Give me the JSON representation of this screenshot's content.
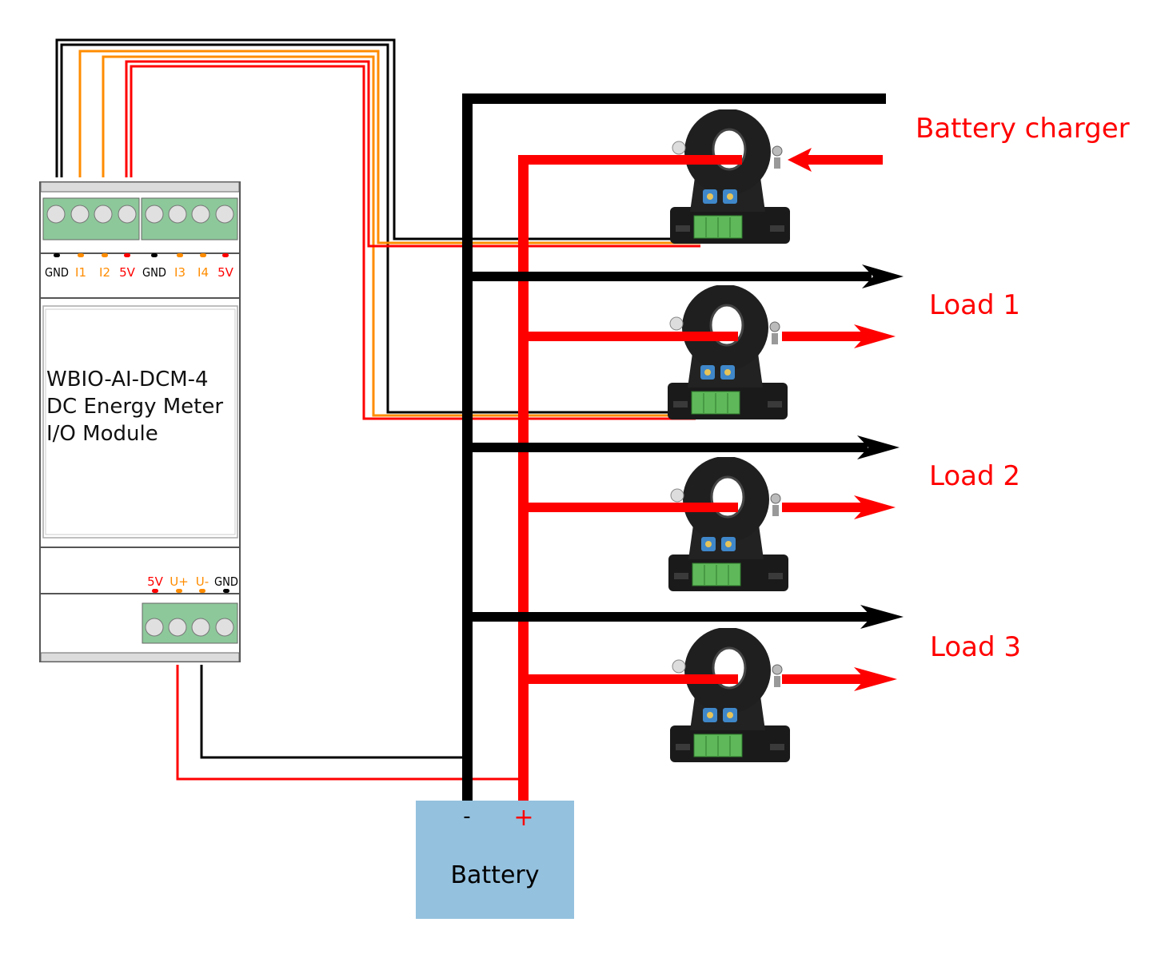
{
  "module": {
    "title_lines": [
      "WBIO-AI-DCM-4",
      "DC Energy Meter",
      "I/O Module"
    ],
    "top_terminals": [
      {
        "label": "GND",
        "color": "#000000"
      },
      {
        "label": "I1",
        "color": "#ff8c00"
      },
      {
        "label": "I2",
        "color": "#ff8c00"
      },
      {
        "label": "5V",
        "color": "#ff0000"
      },
      {
        "label": "GND",
        "color": "#000000"
      },
      {
        "label": "I3",
        "color": "#ff8c00"
      },
      {
        "label": "I4",
        "color": "#ff8c00"
      },
      {
        "label": "5V",
        "color": "#ff0000"
      }
    ],
    "bottom_terminals": [
      {
        "label": "5V",
        "color": "#ff0000"
      },
      {
        "label": "U+",
        "color": "#ff8c00"
      },
      {
        "label": "U-",
        "color": "#ff8c00"
      },
      {
        "label": "GND",
        "color": "#000000"
      }
    ],
    "terminal_block_color": "#8dc89a"
  },
  "labels": {
    "charger": "Battery charger",
    "load1": "Load 1",
    "load2": "Load 2",
    "load3": "Load 3"
  },
  "battery": {
    "label": "Battery",
    "minus": "-",
    "plus": "+",
    "color": "#94c1de"
  },
  "colors": {
    "positive": "#ff0000",
    "negative": "#000000",
    "signal": "#ff8c00"
  }
}
